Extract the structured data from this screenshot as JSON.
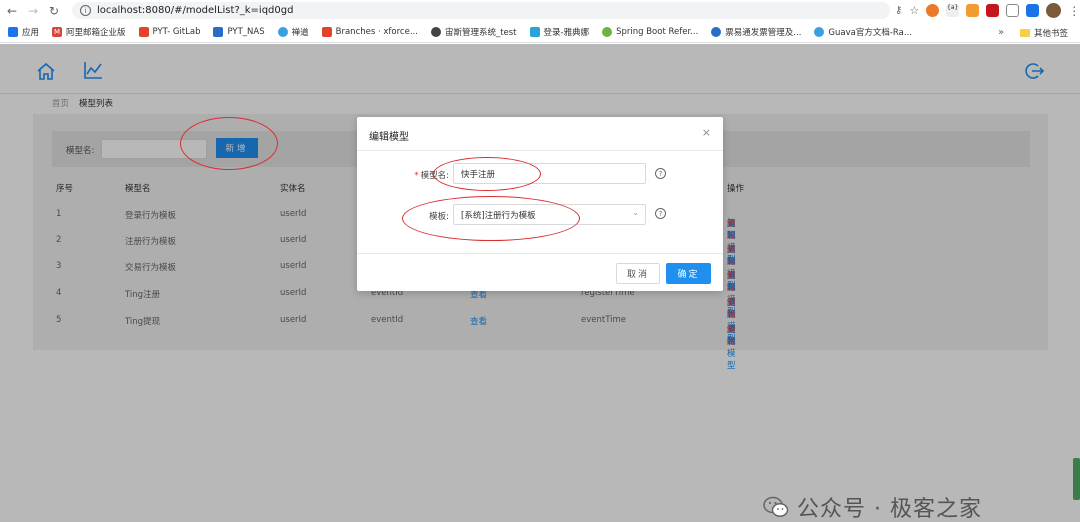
{
  "browser": {
    "url": "localhost:8080/#/modelList?_k=iqd0gd",
    "bookmarks": [
      {
        "label": "应用",
        "color": "#1a73e8"
      },
      {
        "label": "阿里邮箱企业版",
        "color": "#d44638"
      },
      {
        "label": "PYT- GitLab",
        "color": "#e24329"
      },
      {
        "label": "PYT_NAS",
        "color": "#2a6dc8"
      },
      {
        "label": "禅道",
        "color": "#3a9ee0"
      },
      {
        "label": "Branches · xforce...",
        "color": "#e24329"
      },
      {
        "label": "宙斯管理系统_test",
        "color": "#444444"
      },
      {
        "label": "登录-雅典娜",
        "color": "#2aa4d8"
      },
      {
        "label": "Spring Boot Refer...",
        "color": "#6db33f"
      },
      {
        "label": "票易通发票管理及...",
        "color": "#2a6dc8"
      },
      {
        "label": "Guava官方文档-Ra...",
        "color": "#3a9ee0"
      }
    ],
    "more_glyph": "»",
    "other_bookmarks": "其他书签"
  },
  "breadcrumb": {
    "home": "首页",
    "current": "模型列表"
  },
  "filter": {
    "label": "模型名:",
    "value": "",
    "add_button": "新增"
  },
  "table": {
    "headers": [
      "序号",
      "模型名",
      "实体名",
      "",
      "",
      "",
      "操作"
    ],
    "rows": [
      {
        "index": "1",
        "name": "登录行为模板",
        "entity": "userId",
        "event": "",
        "view": "",
        "time": ""
      },
      {
        "index": "2",
        "name": "注册行为模板",
        "entity": "userId",
        "event": "",
        "view": "",
        "time": ""
      },
      {
        "index": "3",
        "name": "交易行为模板",
        "entity": "userId",
        "event": "",
        "view": "",
        "time": ""
      },
      {
        "index": "4",
        "name": "Ting注册",
        "entity": "userId",
        "event": "eventId",
        "view": "查看",
        "time": "registerTime"
      },
      {
        "index": "5",
        "name": "Ting提现",
        "entity": "userId",
        "event": "eventId",
        "view": "查看",
        "time": "eventTime"
      }
    ],
    "ops": {
      "enter": "进入模型",
      "copy": "复制",
      "edit": "编辑",
      "delete": "删除"
    }
  },
  "modal": {
    "title": "编辑模型",
    "close": "×",
    "name_label": "模型名:",
    "name_value": "快手注册",
    "template_label": "模板:",
    "template_value": "[系统]注册行为模板",
    "help": "?",
    "cancel": "取消",
    "ok": "确定"
  },
  "watermark": "公众号 · 极客之家"
}
